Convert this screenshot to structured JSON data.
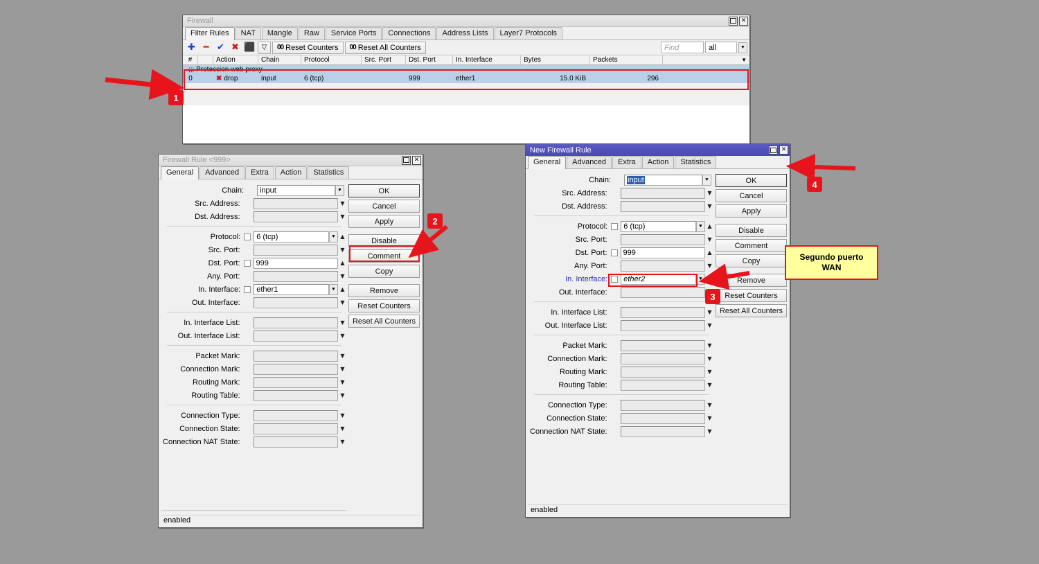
{
  "firewall_window": {
    "title": "Firewall",
    "tabs": [
      {
        "label": "Filter Rules",
        "selected": true
      },
      {
        "label": "NAT",
        "selected": false
      },
      {
        "label": "Mangle",
        "selected": false
      },
      {
        "label": "Raw",
        "selected": false
      },
      {
        "label": "Service Ports",
        "selected": false
      },
      {
        "label": "Connections",
        "selected": false
      },
      {
        "label": "Address Lists",
        "selected": false
      },
      {
        "label": "Layer7 Protocols",
        "selected": false
      }
    ],
    "toolbar": {
      "add_label": "+",
      "remove_label": "−",
      "enable_label": "✔",
      "disable_label": "✖",
      "comment_label": "⬛",
      "filter_label": "▽",
      "reset_counters_label": "Reset Counters",
      "reset_all_counters_label": "Reset All Counters",
      "counter_prefix": "00",
      "find_placeholder": "Find",
      "find_value": "",
      "filter_scope_value": "all"
    },
    "columns": [
      "#",
      "",
      "Action",
      "Chain",
      "Protocol",
      "Src. Port",
      "Dst. Port",
      "In. Interface",
      "Bytes",
      "Packets",
      ""
    ],
    "comment_row": {
      "text": ";;; Proteccion web proxy"
    },
    "rows": [
      {
        "index": "0",
        "action": "drop",
        "chain": "input",
        "protocol": "6 (tcp)",
        "src_port": "",
        "dst_port": "999",
        "in_interface": "ether1",
        "bytes": "15.0 KiB",
        "packets": "296"
      }
    ]
  },
  "rule_dialog": {
    "title": "Firewall Rule <999>",
    "tabs": [
      {
        "label": "General",
        "selected": true
      },
      {
        "label": "Advanced",
        "selected": false
      },
      {
        "label": "Extra",
        "selected": false
      },
      {
        "label": "Action",
        "selected": false
      },
      {
        "label": "Statistics",
        "selected": false
      }
    ],
    "fields": [
      {
        "label": "Chain:",
        "value": "input",
        "kind": "spin",
        "checkbox": false,
        "filled": true
      },
      {
        "label": "Src. Address:",
        "value": "",
        "kind": "dropdown",
        "checkbox": false,
        "filled": false
      },
      {
        "label": "Dst. Address:",
        "value": "",
        "kind": "dropdown",
        "checkbox": false,
        "filled": false
      },
      {
        "label": "Protocol:",
        "value": "6 (tcp)",
        "kind": "spin-up",
        "checkbox": true,
        "filled": true
      },
      {
        "label": "Src. Port:",
        "value": "",
        "kind": "dropdown",
        "checkbox": false,
        "filled": false
      },
      {
        "label": "Dst. Port:",
        "value": "999",
        "kind": "up",
        "checkbox": true,
        "filled": true
      },
      {
        "label": "Any. Port:",
        "value": "",
        "kind": "dropdown",
        "checkbox": false,
        "filled": false
      },
      {
        "label": "In. Interface:",
        "value": "ether1",
        "kind": "spin-up",
        "checkbox": true,
        "filled": true
      },
      {
        "label": "Out. Interface:",
        "value": "",
        "kind": "dropdown",
        "checkbox": false,
        "filled": false
      },
      {
        "label": "In. Interface List:",
        "value": "",
        "kind": "dropdown",
        "checkbox": false,
        "filled": false
      },
      {
        "label": "Out. Interface List:",
        "value": "",
        "kind": "dropdown",
        "checkbox": false,
        "filled": false
      },
      {
        "label": "Packet Mark:",
        "value": "",
        "kind": "dropdown",
        "checkbox": false,
        "filled": false
      },
      {
        "label": "Connection Mark:",
        "value": "",
        "kind": "dropdown",
        "checkbox": false,
        "filled": false
      },
      {
        "label": "Routing Mark:",
        "value": "",
        "kind": "dropdown",
        "checkbox": false,
        "filled": false
      },
      {
        "label": "Routing Table:",
        "value": "",
        "kind": "dropdown",
        "checkbox": false,
        "filled": false
      },
      {
        "label": "Connection Type:",
        "value": "",
        "kind": "dropdown",
        "checkbox": false,
        "filled": false
      },
      {
        "label": "Connection State:",
        "value": "",
        "kind": "dropdown",
        "checkbox": false,
        "filled": false
      },
      {
        "label": "Connection NAT State:",
        "value": "",
        "kind": "dropdown",
        "checkbox": false,
        "filled": false
      }
    ],
    "buttons": [
      {
        "label": "OK",
        "primary": true
      },
      {
        "label": "Cancel",
        "primary": false
      },
      {
        "label": "Apply",
        "primary": false
      },
      {
        "label": "Disable",
        "primary": false
      },
      {
        "label": "Comment",
        "primary": false
      },
      {
        "label": "Copy",
        "primary": false,
        "highlight": true
      },
      {
        "label": "Remove",
        "primary": false
      },
      {
        "label": "Reset Counters",
        "primary": false
      },
      {
        "label": "Reset All Counters",
        "primary": false
      }
    ],
    "status": "enabled"
  },
  "new_rule_dialog": {
    "title": "New Firewall Rule",
    "tabs": [
      {
        "label": "General",
        "selected": true
      },
      {
        "label": "Advanced",
        "selected": false
      },
      {
        "label": "Extra",
        "selected": false
      },
      {
        "label": "Action",
        "selected": false
      },
      {
        "label": "Statistics",
        "selected": false
      }
    ],
    "fields": [
      {
        "label": "Chain:",
        "value": "input",
        "kind": "spin",
        "checkbox": false,
        "filled": true,
        "selected_text": true
      },
      {
        "label": "Src. Address:",
        "value": "",
        "kind": "dropdown",
        "checkbox": false,
        "filled": false
      },
      {
        "label": "Dst. Address:",
        "value": "",
        "kind": "dropdown",
        "checkbox": false,
        "filled": false
      },
      {
        "label": "Protocol:",
        "value": "6 (tcp)",
        "kind": "spin-up",
        "checkbox": true,
        "filled": true
      },
      {
        "label": "Src. Port:",
        "value": "",
        "kind": "dropdown",
        "checkbox": false,
        "filled": false
      },
      {
        "label": "Dst. Port:",
        "value": "999",
        "kind": "up",
        "checkbox": true,
        "filled": true
      },
      {
        "label": "Any. Port:",
        "value": "",
        "kind": "dropdown",
        "checkbox": false,
        "filled": false
      },
      {
        "label": "In. Interface:",
        "value": "ether2",
        "kind": "spin-up",
        "checkbox": true,
        "filled": true,
        "label_accent": true,
        "italic": true,
        "highlight": true
      },
      {
        "label": "Out. Interface:",
        "value": "",
        "kind": "dropdown",
        "checkbox": false,
        "filled": false
      },
      {
        "label": "In. Interface List:",
        "value": "",
        "kind": "dropdown",
        "checkbox": false,
        "filled": false
      },
      {
        "label": "Out. Interface List:",
        "value": "",
        "kind": "dropdown",
        "checkbox": false,
        "filled": false
      },
      {
        "label": "Packet Mark:",
        "value": "",
        "kind": "dropdown",
        "checkbox": false,
        "filled": false
      },
      {
        "label": "Connection Mark:",
        "value": "",
        "kind": "dropdown",
        "checkbox": false,
        "filled": false
      },
      {
        "label": "Routing Mark:",
        "value": "",
        "kind": "dropdown",
        "checkbox": false,
        "filled": false
      },
      {
        "label": "Routing Table:",
        "value": "",
        "kind": "dropdown",
        "checkbox": false,
        "filled": false
      },
      {
        "label": "Connection Type:",
        "value": "",
        "kind": "dropdown",
        "checkbox": false,
        "filled": false
      },
      {
        "label": "Connection State:",
        "value": "",
        "kind": "dropdown",
        "checkbox": false,
        "filled": false
      },
      {
        "label": "Connection NAT State:",
        "value": "",
        "kind": "dropdown",
        "checkbox": false,
        "filled": false
      }
    ],
    "buttons": [
      {
        "label": "OK",
        "primary": true
      },
      {
        "label": "Cancel",
        "primary": false
      },
      {
        "label": "Apply",
        "primary": false
      },
      {
        "label": "Disable",
        "primary": false
      },
      {
        "label": "Comment",
        "primary": false
      },
      {
        "label": "Copy",
        "primary": false
      },
      {
        "label": "Remove",
        "primary": false
      },
      {
        "label": "Reset Counters",
        "primary": false
      },
      {
        "label": "Reset All Counters",
        "primary": false
      }
    ],
    "status": "enabled"
  },
  "annotations": {
    "markers": [
      {
        "id": "1",
        "label": "1"
      },
      {
        "id": "2",
        "label": "2"
      },
      {
        "id": "3",
        "label": "3"
      },
      {
        "id": "4",
        "label": "4"
      }
    ],
    "callout": {
      "line1": "Segundo puerto",
      "line2": "WAN"
    },
    "accent_color": "#e8141b",
    "callout_bg": "#ffff9e"
  }
}
